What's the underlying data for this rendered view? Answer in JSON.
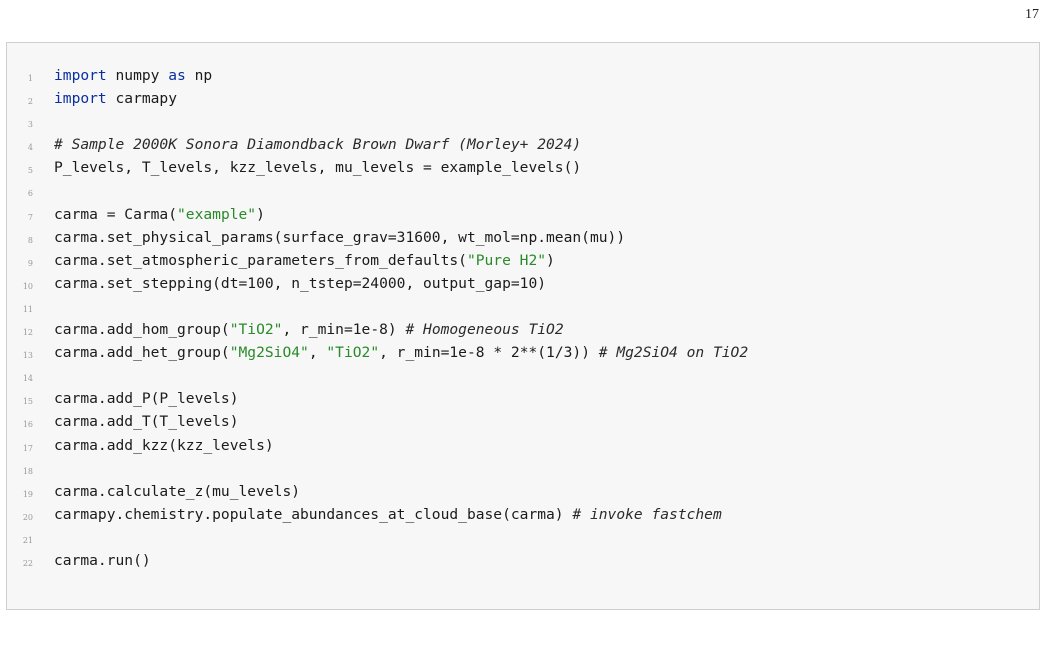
{
  "page": {
    "number": "17"
  },
  "code": {
    "lines": [
      {
        "no": "1",
        "parts": [
          {
            "t": "import",
            "c": "kw"
          },
          {
            "t": " numpy ",
            "c": ""
          },
          {
            "t": "as",
            "c": "kw"
          },
          {
            "t": " np",
            "c": ""
          }
        ]
      },
      {
        "no": "2",
        "parts": [
          {
            "t": "import",
            "c": "kw"
          },
          {
            "t": " carmapy",
            "c": ""
          }
        ]
      },
      {
        "no": "3",
        "parts": []
      },
      {
        "no": "4",
        "parts": [
          {
            "t": "# Sample 2000K Sonora Diamondback Brown Dwarf (Morley+ 2024)",
            "c": "cm"
          }
        ]
      },
      {
        "no": "5",
        "parts": [
          {
            "t": "P_levels, T_levels, kzz_levels, mu_levels = example_levels()",
            "c": ""
          }
        ]
      },
      {
        "no": "6",
        "parts": []
      },
      {
        "no": "7",
        "parts": [
          {
            "t": "carma = Carma(",
            "c": ""
          },
          {
            "t": "\"example\"",
            "c": "str"
          },
          {
            "t": ")",
            "c": ""
          }
        ]
      },
      {
        "no": "8",
        "parts": [
          {
            "t": "carma.set_physical_params(surface_grav=31600, wt_mol=np.mean(mu))",
            "c": ""
          }
        ]
      },
      {
        "no": "9",
        "parts": [
          {
            "t": "carma.set_atmospheric_parameters_from_defaults(",
            "c": ""
          },
          {
            "t": "\"Pure H2\"",
            "c": "str"
          },
          {
            "t": ")",
            "c": ""
          }
        ]
      },
      {
        "no": "10",
        "parts": [
          {
            "t": "carma.set_stepping(dt=100, n_tstep=24000, output_gap=10)",
            "c": ""
          }
        ]
      },
      {
        "no": "11",
        "parts": []
      },
      {
        "no": "12",
        "parts": [
          {
            "t": "carma.add_hom_group(",
            "c": ""
          },
          {
            "t": "\"TiO2\"",
            "c": "str"
          },
          {
            "t": ", r_min=1e-8) ",
            "c": ""
          },
          {
            "t": "# Homogeneous TiO2",
            "c": "cm"
          }
        ]
      },
      {
        "no": "13",
        "parts": [
          {
            "t": "carma.add_het_group(",
            "c": ""
          },
          {
            "t": "\"Mg2SiO4\"",
            "c": "str"
          },
          {
            "t": ", ",
            "c": ""
          },
          {
            "t": "\"TiO2\"",
            "c": "str"
          },
          {
            "t": ", r_min=1e-8 * 2**(1/3)) ",
            "c": ""
          },
          {
            "t": "# Mg2SiO4 on TiO2",
            "c": "cm"
          }
        ]
      },
      {
        "no": "14",
        "parts": []
      },
      {
        "no": "15",
        "parts": [
          {
            "t": "carma.add_P(P_levels)",
            "c": ""
          }
        ]
      },
      {
        "no": "16",
        "parts": [
          {
            "t": "carma.add_T(T_levels)",
            "c": ""
          }
        ]
      },
      {
        "no": "17",
        "parts": [
          {
            "t": "carma.add_kzz(kzz_levels)",
            "c": ""
          }
        ]
      },
      {
        "no": "18",
        "parts": []
      },
      {
        "no": "19",
        "parts": [
          {
            "t": "carma.calculate_z(mu_levels)",
            "c": ""
          }
        ]
      },
      {
        "no": "20",
        "parts": [
          {
            "t": "carmapy.chemistry.populate_abundances_at_cloud_base(carma) ",
            "c": ""
          },
          {
            "t": "# invoke fastchem",
            "c": "cm"
          }
        ]
      },
      {
        "no": "21",
        "parts": []
      },
      {
        "no": "22",
        "parts": [
          {
            "t": "carma.run()",
            "c": ""
          }
        ]
      }
    ]
  }
}
